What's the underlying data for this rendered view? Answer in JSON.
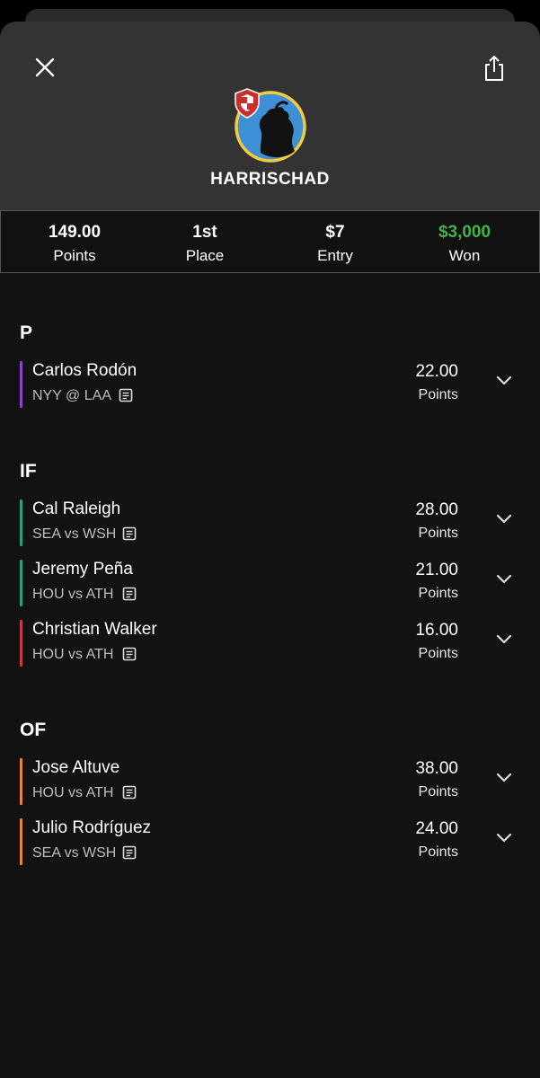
{
  "header": {
    "username": "HARRISCHAD",
    "close_icon": "close-icon",
    "share_icon": "share-icon"
  },
  "stats": [
    {
      "value": "149.00",
      "label": "Points"
    },
    {
      "value": "1st",
      "label": "Place"
    },
    {
      "value": "$7",
      "label": "Entry"
    },
    {
      "value": "$3,000",
      "label": "Won"
    }
  ],
  "sections": [
    {
      "title": "P",
      "players": [
        {
          "name": "Carlos Rodón",
          "game": "NYY @ LAA",
          "points": "22.00",
          "points_label": "Points",
          "color": "#8b45c9"
        }
      ]
    },
    {
      "title": "IF",
      "players": [
        {
          "name": "Cal Raleigh",
          "game": "SEA vs WSH",
          "points": "28.00",
          "points_label": "Points",
          "color": "#2e9f7a"
        },
        {
          "name": "Jeremy Peña",
          "game": "HOU vs ATH",
          "points": "21.00",
          "points_label": "Points",
          "color": "#2e9f7a"
        },
        {
          "name": "Christian Walker",
          "game": "HOU vs ATH",
          "points": "16.00",
          "points_label": "Points",
          "color": "#c9384a"
        }
      ]
    },
    {
      "title": "OF",
      "players": [
        {
          "name": "Jose Altuve",
          "game": "HOU vs ATH",
          "points": "38.00",
          "points_label": "Points",
          "color": "#e8843a"
        },
        {
          "name": "Julio Rodríguez",
          "game": "SEA vs WSH",
          "points": "24.00",
          "points_label": "Points",
          "color": "#e8843a"
        }
      ]
    }
  ],
  "colors": {
    "won": "#3fb548",
    "header_bg": "#333333",
    "page_bg": "#121212"
  }
}
